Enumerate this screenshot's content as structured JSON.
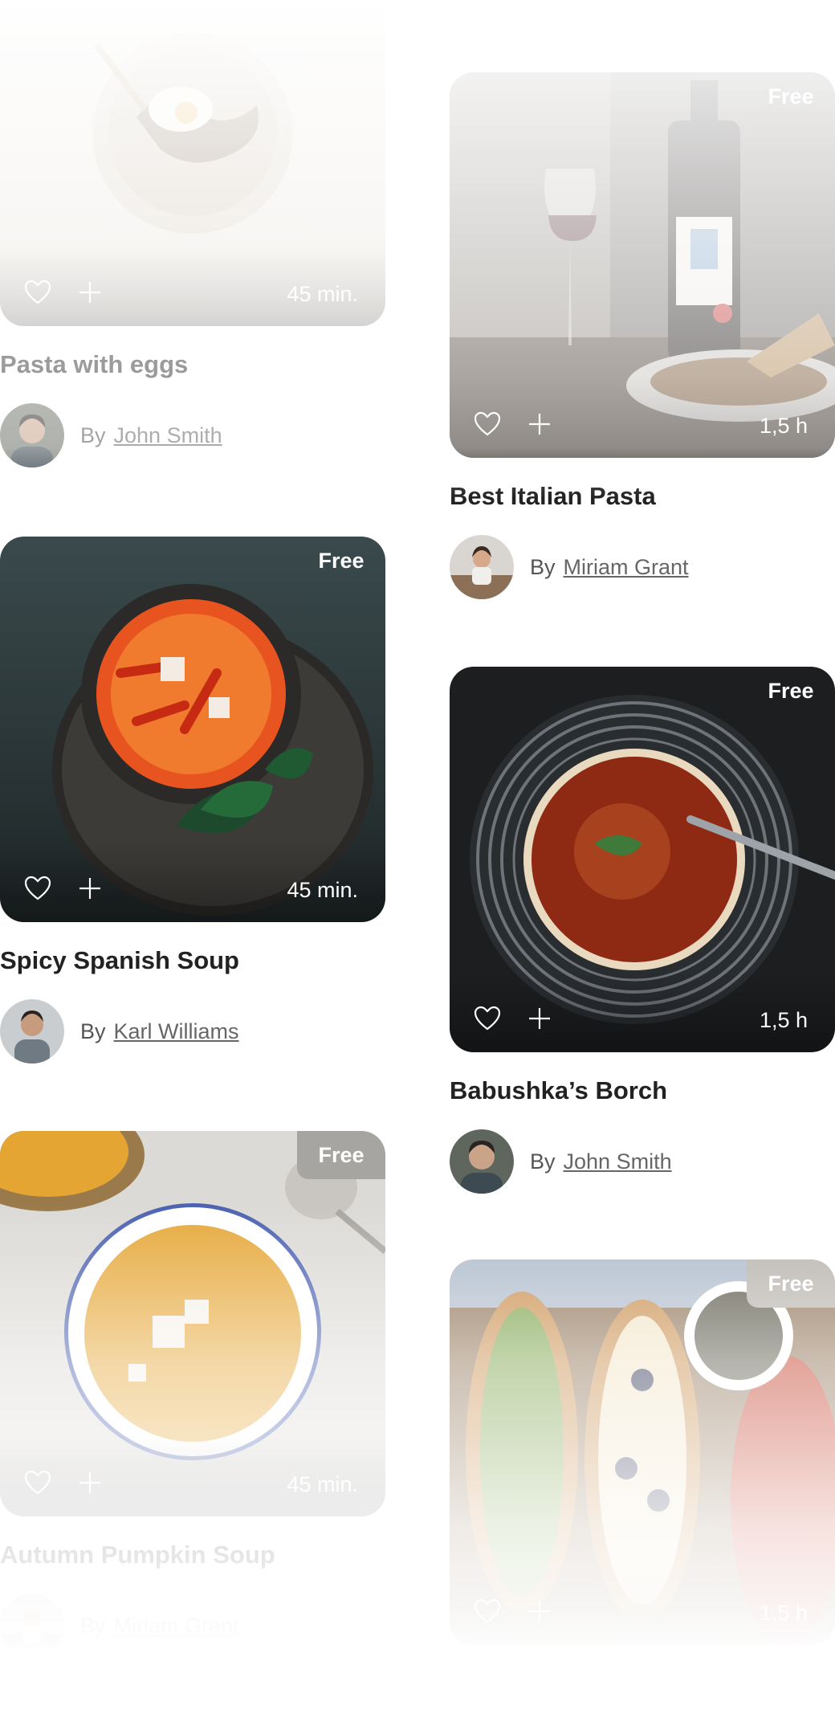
{
  "recipes": [
    {
      "title": "Pasta with eggs",
      "time": "45 min.",
      "badge": "",
      "by": "By",
      "author": "John Smith",
      "image": "pasta-with-eggs-photo",
      "bg": "#e9e4dc"
    },
    {
      "title": "Best Italian Pasta",
      "time": "1,5 h",
      "badge": "Free",
      "by": "By",
      "author": "Miriam Grant",
      "image": "wine-and-pasta-photo",
      "bg": "#6e6a64"
    },
    {
      "title": "Spicy Spanish Soup",
      "time": "45 min.",
      "badge": "Free",
      "by": "By",
      "author": "Karl Williams",
      "image": "spicy-soup-photo",
      "bg": "#2f3b3d"
    },
    {
      "title": "Babushka’s Borch",
      "time": "1,5 h",
      "badge": "Free",
      "by": "By",
      "author": "John Smith",
      "image": "borch-photo",
      "bg": "#1e2022"
    },
    {
      "title": "Autumn Pumpkin Soup",
      "time": "45 min.",
      "badge": "Free",
      "by": "By",
      "author": "Miriam Grant",
      "image": "pumpkin-soup-photo",
      "bg": "#e6e4e1"
    },
    {
      "title": "",
      "time": "1,5 h",
      "badge": "Free",
      "by": "",
      "author": "",
      "image": "toast-platter-photo",
      "bg": "#b09a7f"
    }
  ],
  "icons": {
    "like": "heart-outline-icon",
    "add": "plus-icon"
  },
  "colors": {
    "accent_text": "#ffffff",
    "author_link": "#666666",
    "title": "#222222"
  }
}
